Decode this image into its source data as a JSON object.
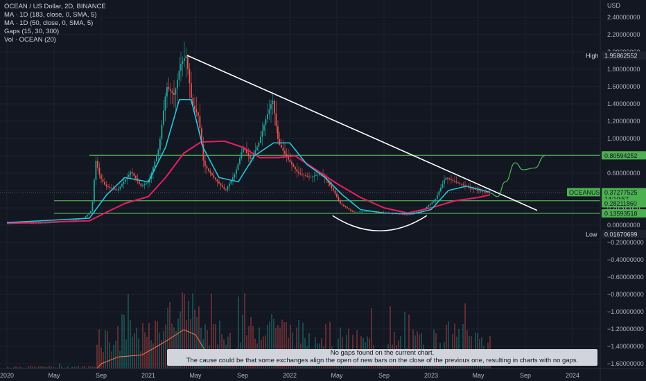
{
  "legend": {
    "title": "OCEAN / US Dollar, 2D, BINANCE",
    "ma1": "MA · 1D (183, close, 0, SMA, 5)",
    "ma2": "MA · 1D (50, close, 0, SMA, 5)",
    "gaps": "Gaps (15, 30, 300)",
    "vol": "Vol · OCEAN (20)"
  },
  "currency": "USD",
  "price_axis": {
    "ticks": [
      "2.40000000",
      "2.20000000",
      "2.00000000",
      "1.80000000",
      "1.60000000",
      "1.40000000",
      "1.20000000",
      "1.00000000",
      "0.80000000",
      "0.60000000",
      "0.40000000",
      "0.20000000",
      "0.00000000",
      "−0.20000000",
      "−0.40000000",
      "−0.60000000",
      "−0.80000000",
      "−1.00000000",
      "−1.20000000",
      "−1.40000000",
      "−1.60000000"
    ],
    "tags": {
      "high_label": "High",
      "high_value": "1.95862552",
      "level_upper": "0.80594252",
      "symbol": "OCEANUSD",
      "last_price": "0.37277525",
      "countdown": "14:10:57",
      "level_mid": "0.28211860",
      "level_low": "0.13593518",
      "low_label": "Low",
      "low_value": "0.01670699"
    }
  },
  "time_axis": [
    "2020",
    "May",
    "Sep",
    "2021",
    "May",
    "Sep",
    "2022",
    "May",
    "Sep",
    "2023",
    "May",
    "Sep",
    "2024"
  ],
  "notice": {
    "line1": "No gaps found on the current chart.",
    "line2": "The cause could be that some exchanges align the open of new bars on the close of the previous one, resulting in charts with no gaps."
  },
  "colors": {
    "background": "#131722",
    "up": "#26a69a",
    "down": "#ef5350",
    "ma183": "#e91e63",
    "ma50": "#26c6da",
    "levels": "#4caf50",
    "trendline": "#ffffff",
    "volume_ma": "#f57c53"
  },
  "chart_data": {
    "type": "candlestick",
    "title": "OCEAN / US Dollar, 2D, BINANCE",
    "y_unit": "USD",
    "ylim": [
      -1.7,
      2.5
    ],
    "x_range": [
      "2020-01",
      "2024-02"
    ],
    "high": 1.95862552,
    "low": 0.01670699,
    "last": 0.37277525,
    "price_path": [
      [
        "2020-01-01",
        0.03
      ],
      [
        "2020-03-15",
        0.02
      ],
      [
        "2020-05-01",
        0.03
      ],
      [
        "2020-06-15",
        0.05
      ],
      [
        "2020-07-20",
        0.08
      ],
      [
        "2020-08-10",
        0.18
      ],
      [
        "2020-08-20",
        0.75
      ],
      [
        "2020-09-01",
        0.55
      ],
      [
        "2020-09-15",
        0.45
      ],
      [
        "2020-10-15",
        0.4
      ],
      [
        "2020-11-20",
        0.62
      ],
      [
        "2020-12-15",
        0.45
      ],
      [
        "2021-01-05",
        0.5
      ],
      [
        "2021-02-01",
        0.9
      ],
      [
        "2021-02-20",
        1.6
      ],
      [
        "2021-03-10",
        1.5
      ],
      [
        "2021-03-25",
        1.85
      ],
      [
        "2021-04-10",
        1.96
      ],
      [
        "2021-04-25",
        1.4
      ],
      [
        "2021-05-12",
        1.25
      ],
      [
        "2021-05-25",
        0.7
      ],
      [
        "2021-06-20",
        0.55
      ],
      [
        "2021-07-20",
        0.4
      ],
      [
        "2021-08-15",
        0.6
      ],
      [
        "2021-09-05",
        0.9
      ],
      [
        "2021-09-25",
        0.75
      ],
      [
        "2021-10-15",
        0.95
      ],
      [
        "2021-11-01",
        1.2
      ],
      [
        "2021-11-20",
        1.45
      ],
      [
        "2021-12-05",
        0.95
      ],
      [
        "2022-01-01",
        0.75
      ],
      [
        "2022-01-25",
        0.6
      ],
      [
        "2022-02-25",
        0.55
      ],
      [
        "2022-03-25",
        0.6
      ],
      [
        "2022-04-25",
        0.4
      ],
      [
        "2022-05-12",
        0.25
      ],
      [
        "2022-06-15",
        0.15
      ],
      [
        "2022-08-01",
        0.16
      ],
      [
        "2022-09-15",
        0.14
      ],
      [
        "2022-11-01",
        0.12
      ],
      [
        "2022-12-15",
        0.18
      ],
      [
        "2023-01-15",
        0.3
      ],
      [
        "2023-02-10",
        0.55
      ],
      [
        "2023-03-05",
        0.5
      ],
      [
        "2023-04-01",
        0.45
      ],
      [
        "2023-05-01",
        0.4
      ],
      [
        "2023-06-01",
        0.37
      ]
    ],
    "series": [
      {
        "name": "MA · 1D (183, close, 0, SMA, 5)",
        "points": [
          [
            "2020-01-01",
            0.02
          ],
          [
            "2020-08-01",
            0.05
          ],
          [
            "2020-09-15",
            0.15
          ],
          [
            "2020-11-01",
            0.25
          ],
          [
            "2021-01-01",
            0.33
          ],
          [
            "2021-02-15",
            0.55
          ],
          [
            "2021-04-01",
            0.83
          ],
          [
            "2021-05-15",
            0.96
          ],
          [
            "2021-07-15",
            0.97
          ],
          [
            "2021-09-01",
            0.9
          ],
          [
            "2021-10-15",
            0.78
          ],
          [
            "2021-12-01",
            0.78
          ],
          [
            "2022-01-15",
            0.8
          ],
          [
            "2022-03-01",
            0.66
          ],
          [
            "2022-05-01",
            0.48
          ],
          [
            "2022-07-01",
            0.32
          ],
          [
            "2022-09-01",
            0.2
          ],
          [
            "2022-11-01",
            0.14
          ],
          [
            "2023-01-01",
            0.2
          ],
          [
            "2023-03-01",
            0.28
          ],
          [
            "2023-05-01",
            0.32
          ],
          [
            "2023-06-01",
            0.35
          ]
        ]
      },
      {
        "name": "MA · 1D (50, close, 0, SMA, 5)",
        "points": [
          [
            "2020-01-01",
            0.03
          ],
          [
            "2020-08-01",
            0.08
          ],
          [
            "2020-09-15",
            0.35
          ],
          [
            "2020-11-01",
            0.55
          ],
          [
            "2021-01-01",
            0.5
          ],
          [
            "2021-02-15",
            0.9
          ],
          [
            "2021-03-20",
            1.45
          ],
          [
            "2021-04-20",
            1.45
          ],
          [
            "2021-05-20",
            0.9
          ],
          [
            "2021-07-01",
            0.55
          ],
          [
            "2021-08-20",
            0.5
          ],
          [
            "2021-10-01",
            0.8
          ],
          [
            "2021-11-20",
            0.95
          ],
          [
            "2022-01-01",
            0.95
          ],
          [
            "2022-02-15",
            0.7
          ],
          [
            "2022-04-01",
            0.55
          ],
          [
            "2022-05-15",
            0.35
          ],
          [
            "2022-07-01",
            0.18
          ],
          [
            "2022-09-01",
            0.14
          ],
          [
            "2022-11-15",
            0.13
          ],
          [
            "2023-01-01",
            0.18
          ],
          [
            "2023-02-15",
            0.4
          ],
          [
            "2023-04-01",
            0.45
          ],
          [
            "2023-06-01",
            0.38
          ]
        ]
      }
    ],
    "levels": [
      0.80594252,
      0.2821186,
      0.13593518
    ],
    "trendline": [
      [
        "2021-04-10",
        1.96
      ],
      [
        "2023-10-01",
        0.17
      ]
    ],
    "projection": [
      [
        "2023-06-01",
        0.37
      ],
      [
        "2023-06-20",
        0.33
      ],
      [
        "2023-07-10",
        0.5
      ],
      [
        "2023-08-05",
        0.72
      ],
      [
        "2023-08-25",
        0.64
      ],
      [
        "2023-09-25",
        0.66
      ],
      [
        "2023-10-20",
        0.8
      ]
    ],
    "volume_ma": [
      [
        "2020-01-01",
        0
      ],
      [
        "2020-08-20",
        0
      ],
      [
        "2020-09-01",
        0.05
      ],
      [
        "2020-10-15",
        0.12
      ],
      [
        "2020-12-15",
        0.14
      ],
      [
        "2021-02-15",
        0.28
      ],
      [
        "2021-04-01",
        0.4
      ],
      [
        "2021-05-01",
        0.35
      ],
      [
        "2021-06-01",
        0.15
      ],
      [
        "2021-08-01",
        0.08
      ]
    ]
  }
}
